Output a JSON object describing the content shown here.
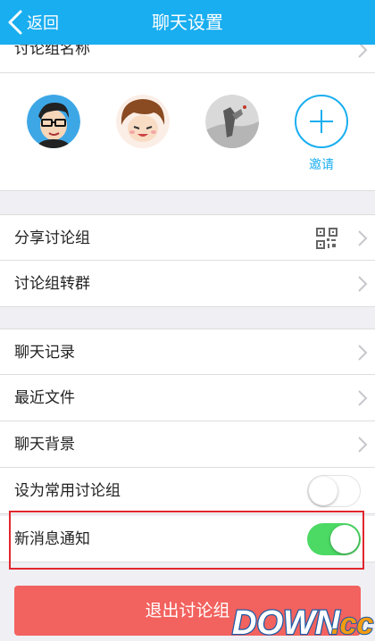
{
  "header": {
    "back_label": "返回",
    "title": "聊天设置"
  },
  "group_name_row": {
    "label": "讨论组名称"
  },
  "members": {
    "avatars": [
      "avatar-glasses-boy",
      "avatar-brown-hair",
      "avatar-grayscale-photo"
    ],
    "invite_label": "邀请"
  },
  "section1": [
    {
      "label": "分享讨论组",
      "icon": "qr-code-icon"
    },
    {
      "label": "讨论组转群"
    }
  ],
  "section2": [
    {
      "label": "聊天记录"
    },
    {
      "label": "最近文件"
    },
    {
      "label": "聊天背景"
    },
    {
      "label": "设为常用讨论组",
      "toggle": false
    },
    {
      "label": "新消息通知",
      "toggle": true
    }
  ],
  "exit_button": {
    "label": "退出讨论组"
  },
  "watermark": {
    "text": "DOWN.CC"
  },
  "colors": {
    "header": "#19aef0",
    "toggle_on": "#4cd964",
    "exit_button": "#f2625e",
    "highlight": "#e1262d"
  }
}
